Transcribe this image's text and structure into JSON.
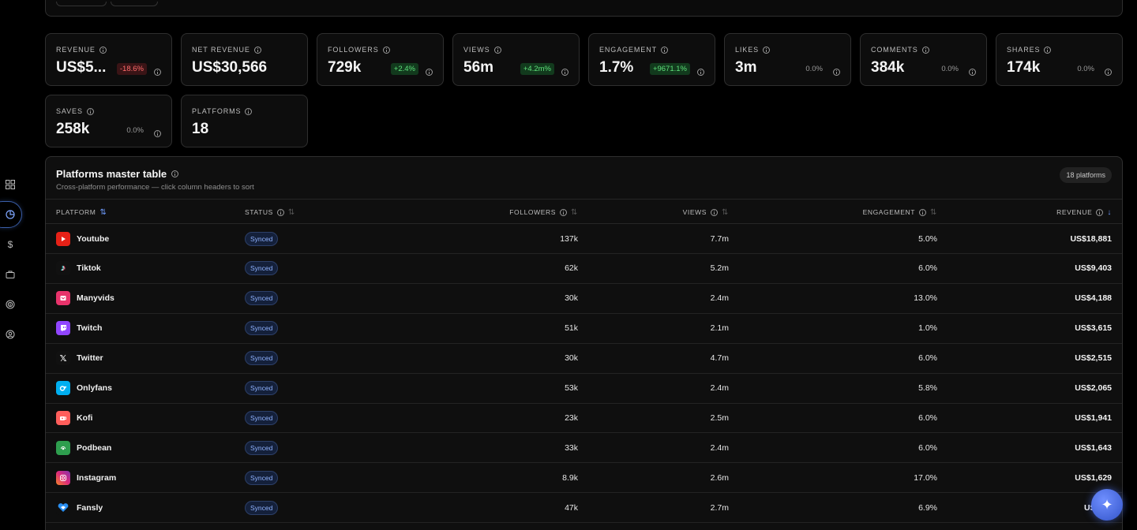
{
  "metrics": [
    {
      "label": "REVENUE",
      "value": "US$5...",
      "delta": "-18.6%",
      "delta_type": "neg"
    },
    {
      "label": "NET REVENUE",
      "value": "US$30,566",
      "delta": "",
      "delta_type": "none"
    },
    {
      "label": "FOLLOWERS",
      "value": "729k",
      "delta": "+2.4%",
      "delta_type": "pos"
    },
    {
      "label": "VIEWS",
      "value": "56m",
      "delta": "+4.2m%",
      "delta_type": "pos"
    },
    {
      "label": "ENGAGEMENT",
      "value": "1.7%",
      "delta": "+9671.1%",
      "delta_type": "pos"
    },
    {
      "label": "LIKES",
      "value": "3m",
      "delta": "0.0%",
      "delta_type": "flat"
    },
    {
      "label": "COMMENTS",
      "value": "384k",
      "delta": "0.0%",
      "delta_type": "flat"
    },
    {
      "label": "SHARES",
      "value": "174k",
      "delta": "0.0%",
      "delta_type": "flat"
    },
    {
      "label": "SAVES",
      "value": "258k",
      "delta": "0.0%",
      "delta_type": "flat"
    },
    {
      "label": "PLATFORMS",
      "value": "18",
      "delta": "",
      "delta_type": "none"
    }
  ],
  "table": {
    "title": "Platforms master table",
    "subtitle": "Cross-platform performance — click column headers to sort",
    "badge": "18 platforms",
    "headers": {
      "platform": "PLATFORM",
      "status": "STATUS",
      "followers": "FOLLOWERS",
      "views": "VIEWS",
      "engagement": "ENGAGEMENT",
      "revenue": "REVENUE"
    },
    "rows": [
      {
        "name": "Youtube",
        "logo": "youtube-logo",
        "status": "Synced",
        "followers": "137k",
        "views": "7.7m",
        "engagement": "5.0%",
        "revenue": "US$18,881"
      },
      {
        "name": "Tiktok",
        "logo": "tiktok-logo",
        "status": "Synced",
        "followers": "62k",
        "views": "5.2m",
        "engagement": "6.0%",
        "revenue": "US$9,403"
      },
      {
        "name": "Manyvids",
        "logo": "manyvids-logo",
        "status": "Synced",
        "followers": "30k",
        "views": "2.4m",
        "engagement": "13.0%",
        "revenue": "US$4,188"
      },
      {
        "name": "Twitch",
        "logo": "twitch-logo",
        "status": "Synced",
        "followers": "51k",
        "views": "2.1m",
        "engagement": "1.0%",
        "revenue": "US$3,615"
      },
      {
        "name": "Twitter",
        "logo": "twitter-x-logo",
        "status": "Synced",
        "followers": "30k",
        "views": "4.7m",
        "engagement": "6.0%",
        "revenue": "US$2,515"
      },
      {
        "name": "Onlyfans",
        "logo": "onlyfans-logo",
        "status": "Synced",
        "followers": "53k",
        "views": "2.4m",
        "engagement": "5.8%",
        "revenue": "US$2,065"
      },
      {
        "name": "Kofi",
        "logo": "kofi-logo",
        "status": "Synced",
        "followers": "23k",
        "views": "2.5m",
        "engagement": "6.0%",
        "revenue": "US$1,941"
      },
      {
        "name": "Podbean",
        "logo": "podbean-logo",
        "status": "Synced",
        "followers": "33k",
        "views": "2.4m",
        "engagement": "6.0%",
        "revenue": "US$1,643"
      },
      {
        "name": "Instagram",
        "logo": "instagram-logo",
        "status": "Synced",
        "followers": "8.9k",
        "views": "2.6m",
        "engagement": "17.0%",
        "revenue": "US$1,629"
      },
      {
        "name": "Fansly",
        "logo": "fansly-logo",
        "status": "Synced",
        "followers": "47k",
        "views": "2.7m",
        "engagement": "6.9%",
        "revenue": "US$1..."
      }
    ]
  },
  "colors": {
    "accent": "#6f9cff",
    "positive": "#5ee07a",
    "negative": "#ff6b6b"
  }
}
